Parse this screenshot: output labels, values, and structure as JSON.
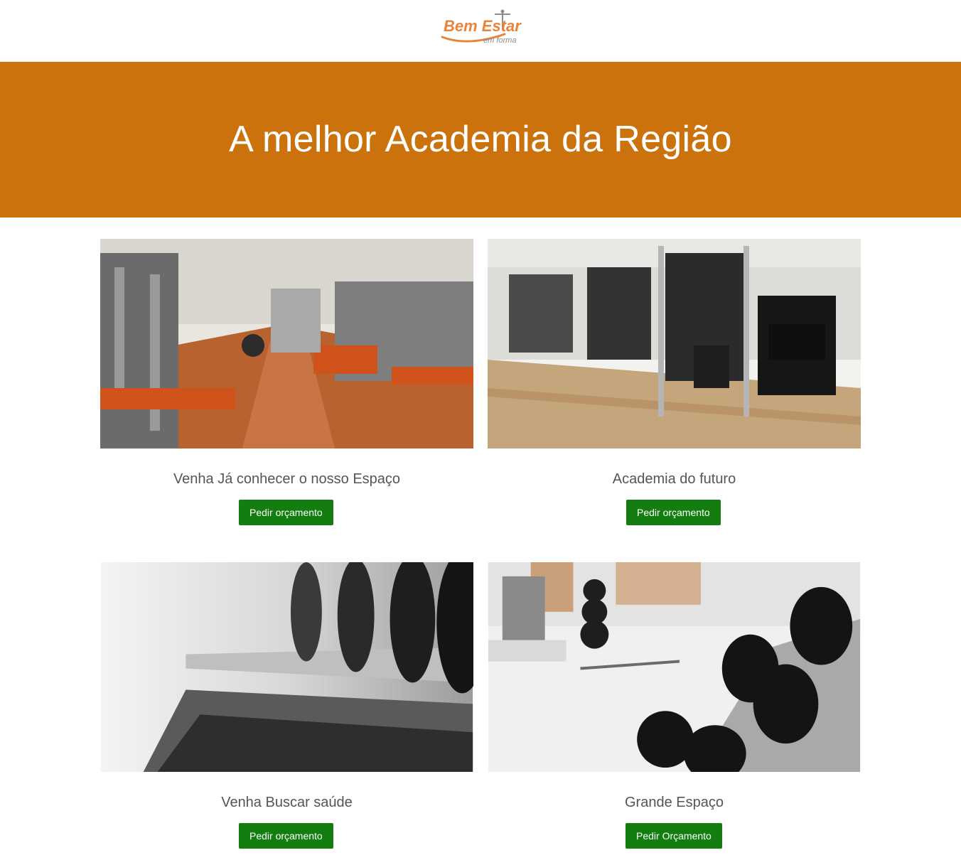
{
  "header": {
    "logo_main": "Bem Estar",
    "logo_sub": "em forma"
  },
  "hero": {
    "title": "A melhor Academia da Região"
  },
  "colors": {
    "hero_bg": "#cb720d",
    "button_bg": "#137d10",
    "logo_orange": "#e8843a"
  },
  "cards": [
    {
      "image": "gym-interior-orange-floor-photo",
      "caption": "Venha Já conhecer o nosso Espaço",
      "button": "Pedir orçamento"
    },
    {
      "image": "gym-machines-wood-floor-photo",
      "caption": "Academia do futuro",
      "button": "Pedir orçamento"
    },
    {
      "image": "dumbbell-rack-blurred-photo",
      "caption": "Venha Buscar saúde",
      "button": "Pedir orçamento"
    },
    {
      "image": "dumbbell-rack-bright-gym-photo",
      "caption": "Grande Espaço",
      "button": "Pedir Orçamento"
    }
  ]
}
